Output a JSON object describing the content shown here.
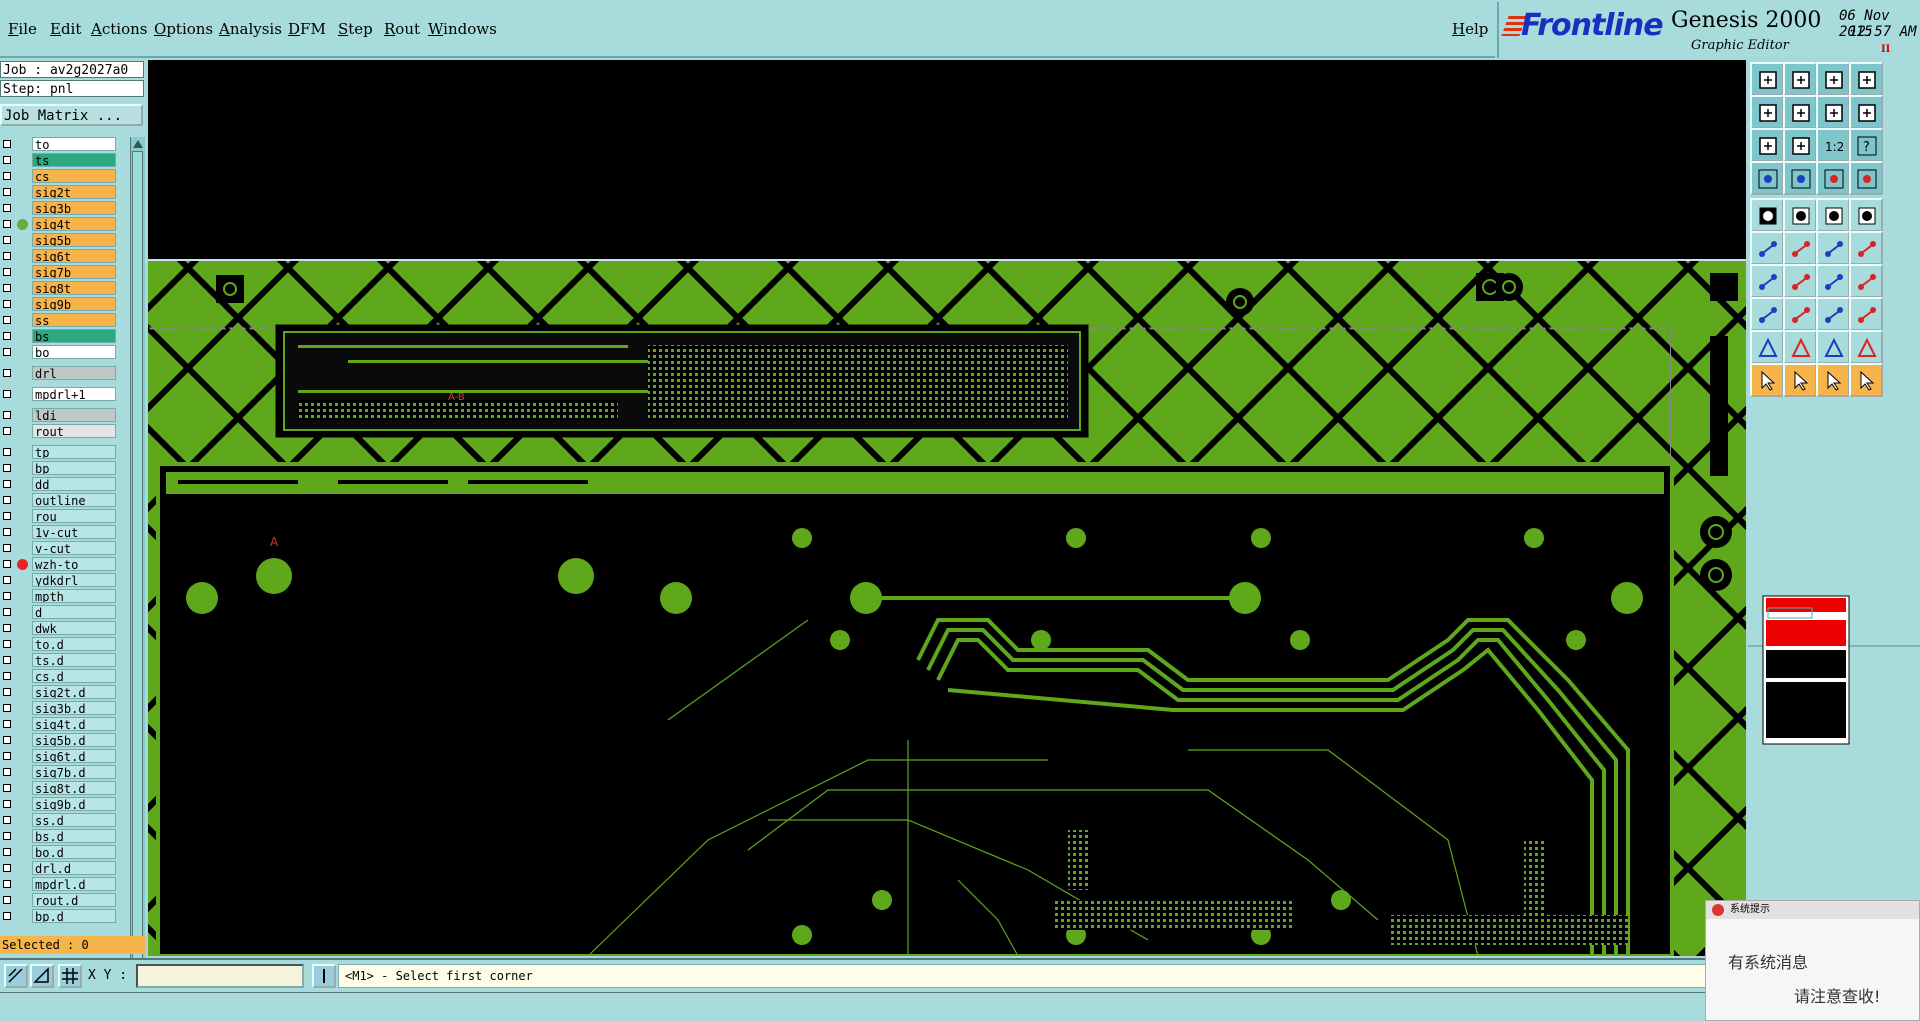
{
  "menubar": {
    "items": [
      "File",
      "Edit",
      "Actions",
      "Options",
      "Analysis",
      "DFM",
      "Step",
      "Rout",
      "Windows"
    ],
    "help": "Help"
  },
  "brand": {
    "logo": "Frontline",
    "product": "Genesis 2000",
    "subtitle": "Graphic Editor",
    "date": "06 Nov 2015",
    "time": "12:57 AM",
    "pause": "II"
  },
  "left_panel": {
    "job": "Job : av2g2027a0",
    "step": "Step: pnl",
    "job_matrix": "Job Matrix ...",
    "selected": "Selected : 0"
  },
  "layers": [
    {
      "name": "to",
      "color": "#ffffff",
      "dot": ""
    },
    {
      "name": "ts",
      "color": "#2aa880",
      "dot": ""
    },
    {
      "name": "cs",
      "color": "#f6b44a",
      "dot": ""
    },
    {
      "name": "sig2t",
      "color": "#f6b44a",
      "dot": ""
    },
    {
      "name": "sig3b",
      "color": "#f6b44a",
      "dot": ""
    },
    {
      "name": "sig4t",
      "color": "#f6b44a",
      "dot": "#5fb13a"
    },
    {
      "name": "sig5b",
      "color": "#f6b44a",
      "dot": ""
    },
    {
      "name": "sig6t",
      "color": "#f6b44a",
      "dot": ""
    },
    {
      "name": "sig7b",
      "color": "#f6b44a",
      "dot": ""
    },
    {
      "name": "sig8t",
      "color": "#f6b44a",
      "dot": ""
    },
    {
      "name": "sig9b",
      "color": "#f6b44a",
      "dot": ""
    },
    {
      "name": "ss",
      "color": "#f6b44a",
      "dot": ""
    },
    {
      "name": "bs",
      "color": "#2aa880",
      "dot": ""
    },
    {
      "name": "bo",
      "color": "#ffffff",
      "dot": ""
    },
    {
      "name": "drl",
      "color": "#bfc7c7",
      "dot": ""
    },
    {
      "name": "mpdrl+1",
      "color": "#ffffff",
      "dot": ""
    },
    {
      "name": "ldi",
      "color": "#bfc7c7",
      "dot": ""
    },
    {
      "name": "rout",
      "color": "#e4e4e4",
      "dot": ""
    },
    {
      "name": "tp",
      "color": "#b8e6e6",
      "dot": ""
    },
    {
      "name": "bp",
      "color": "#b8e6e6",
      "dot": ""
    },
    {
      "name": "dd",
      "color": "#b8e6e6",
      "dot": ""
    },
    {
      "name": "outline",
      "color": "#b8e6e6",
      "dot": ""
    },
    {
      "name": "rou",
      "color": "#b8e6e6",
      "dot": ""
    },
    {
      "name": "1v-cut",
      "color": "#b8e6e6",
      "dot": ""
    },
    {
      "name": "v-cut",
      "color": "#b8e6e6",
      "dot": ""
    },
    {
      "name": "wzh-to",
      "color": "#b8e6e6",
      "dot": "#e22"
    },
    {
      "name": "ydkdrl",
      "color": "#b8e6e6",
      "dot": ""
    },
    {
      "name": "mpth",
      "color": "#b8e6e6",
      "dot": ""
    },
    {
      "name": "d",
      "color": "#b8e6e6",
      "dot": ""
    },
    {
      "name": "dwk",
      "color": "#b8e6e6",
      "dot": ""
    },
    {
      "name": "to.d",
      "color": "#b8e6e6",
      "dot": ""
    },
    {
      "name": "ts.d",
      "color": "#b8e6e6",
      "dot": ""
    },
    {
      "name": "cs.d",
      "color": "#b8e6e6",
      "dot": ""
    },
    {
      "name": "sig2t.d",
      "color": "#b8e6e6",
      "dot": ""
    },
    {
      "name": "sig3b.d",
      "color": "#b8e6e6",
      "dot": ""
    },
    {
      "name": "sig4t.d",
      "color": "#b8e6e6",
      "dot": ""
    },
    {
      "name": "sig5b.d",
      "color": "#b8e6e6",
      "dot": ""
    },
    {
      "name": "sig6t.d",
      "color": "#b8e6e6",
      "dot": ""
    },
    {
      "name": "sig7b.d",
      "color": "#b8e6e6",
      "dot": ""
    },
    {
      "name": "sig8t.d",
      "color": "#b8e6e6",
      "dot": ""
    },
    {
      "name": "sig9b.d",
      "color": "#b8e6e6",
      "dot": ""
    },
    {
      "name": "ss.d",
      "color": "#b8e6e6",
      "dot": ""
    },
    {
      "name": "bs.d",
      "color": "#b8e6e6",
      "dot": ""
    },
    {
      "name": "bo.d",
      "color": "#b8e6e6",
      "dot": ""
    },
    {
      "name": "drl.d",
      "color": "#b8e6e6",
      "dot": ""
    },
    {
      "name": "mpdrl.d",
      "color": "#b8e6e6",
      "dot": ""
    },
    {
      "name": "rout.d",
      "color": "#b8e6e6",
      "dot": ""
    },
    {
      "name": "bp.d",
      "color": "#b8e6e6",
      "dot": ""
    }
  ],
  "canvas": {
    "board_color": "#5fa81c",
    "background": "#000000",
    "marker_a": "A",
    "marker_ab": "A-B"
  },
  "tools": {
    "labels": [
      "1:2",
      "?"
    ]
  },
  "statusbar": {
    "xy_label": "X Y :",
    "xy_value": "",
    "prompt": "<M1> - Select first corner"
  },
  "popup": {
    "title": "系统提示",
    "line1": "有系统消息",
    "line2": "请注意查收!"
  }
}
